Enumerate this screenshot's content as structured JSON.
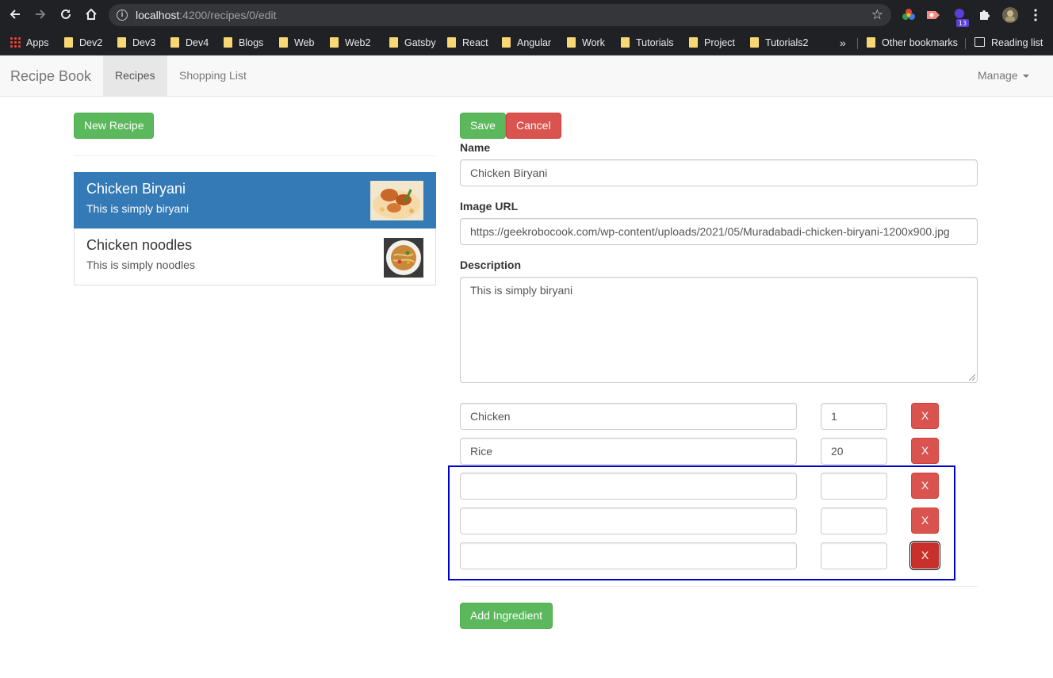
{
  "browser": {
    "url_host": "localhost",
    "url_path": ":4200/recipes/0/edit",
    "extension_badge": "13",
    "bookmarks": [
      "Apps",
      "Dev2",
      "Dev3",
      "Dev4",
      "Blogs",
      "Web",
      "Web2",
      "Gatsby",
      "React",
      "Angular",
      "Work",
      "Tutorials",
      "Project",
      "Tutorials2"
    ],
    "overflow": "»",
    "other_bookmarks": "Other bookmarks",
    "reading_list": "Reading list"
  },
  "navbar": {
    "brand": "Recipe Book",
    "links": [
      "Recipes",
      "Shopping List"
    ],
    "manage": "Manage"
  },
  "recipe_list": {
    "new_button": "New Recipe",
    "items": [
      {
        "name": "Chicken Biryani",
        "description": "This is simply biryani"
      },
      {
        "name": "Chicken noodles",
        "description": "This is simply noodles"
      }
    ]
  },
  "form": {
    "save": "Save",
    "cancel": "Cancel",
    "name_label": "Name",
    "name_value": "Chicken Biryani",
    "image_label": "Image URL",
    "image_value": "https://geekrobocook.com/wp-content/uploads/2021/05/Muradabadi-chicken-biryani-1200x900.jpg",
    "description_label": "Description",
    "description_value": "This is simply biryani",
    "ingredients": [
      {
        "name": "Chicken",
        "amount": "1"
      },
      {
        "name": "Rice",
        "amount": "20"
      },
      {
        "name": "",
        "amount": ""
      },
      {
        "name": "",
        "amount": ""
      },
      {
        "name": "",
        "amount": ""
      }
    ],
    "remove_label": "X",
    "add_ingredient": "Add Ingredient"
  },
  "colors": {
    "success": "#5cb85c",
    "danger": "#d9534f",
    "active_item": "#337ab7",
    "highlight_box": "#0000cc"
  }
}
